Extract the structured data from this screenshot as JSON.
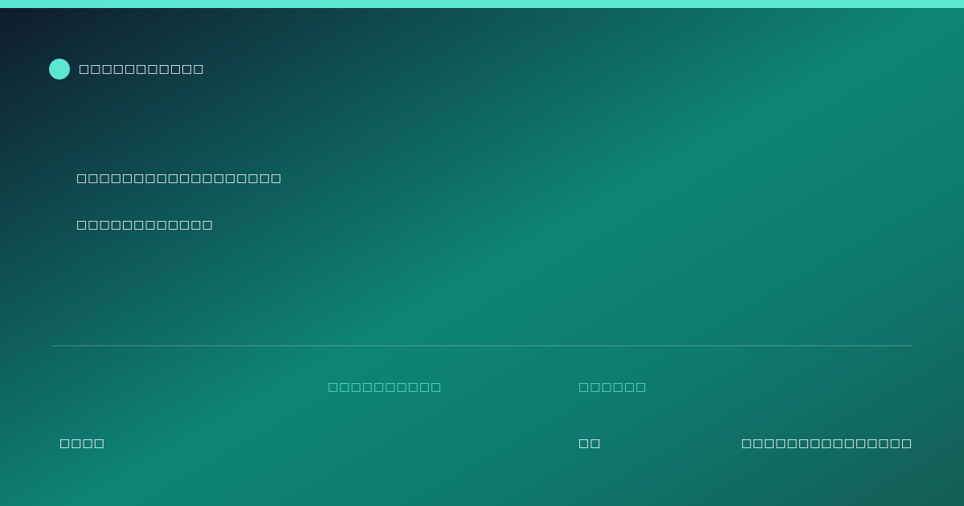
{
  "colors": {
    "accent": "#5ce6d4",
    "top_bar": "#5ce6d4",
    "bg_dark": "#0f1a2c",
    "bg_teal": "#0e8478",
    "text": "#ffffff"
  },
  "brand": {
    "icon": "dot-icon",
    "name": "□□□□□□□□□□□"
  },
  "hero": {
    "headline": "□□□□□□□□□□□□□□□□□□",
    "subline": "□□□□□□□□□□□□"
  },
  "footer": {
    "label_a": "□□□□□□□□□□",
    "label_b": "□□□□□□",
    "value_1": "□□□□",
    "value_2": "□□",
    "value_3": "□□□□□□□□□□□□□□□"
  }
}
